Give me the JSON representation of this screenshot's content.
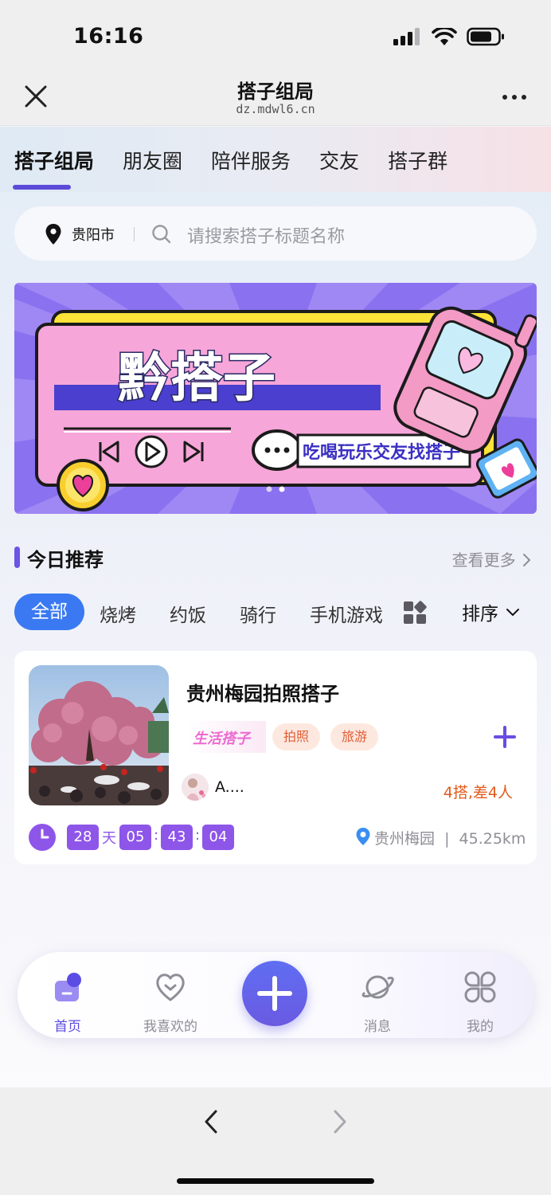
{
  "status": {
    "time": "16:16"
  },
  "nav": {
    "title": "搭子组局",
    "url": "dz.mdwl6.cn"
  },
  "tabs": [
    {
      "label": "搭子组局",
      "active": true
    },
    {
      "label": "朋友圈"
    },
    {
      "label": "陪伴服务"
    },
    {
      "label": "交友"
    },
    {
      "label": "搭子群"
    }
  ],
  "search": {
    "city": "贵阳市",
    "placeholder": "请搜索搭子标题名称"
  },
  "banner": {
    "title": "黔搭子",
    "subtitle": "吃喝玩乐交友找搭子",
    "page_count": 2,
    "active_page": 2
  },
  "section": {
    "title": "今日推荐",
    "more": "查看更多"
  },
  "categories": [
    {
      "label": "全部",
      "active": true
    },
    {
      "label": "烧烤"
    },
    {
      "label": "约饭"
    },
    {
      "label": "骑行"
    },
    {
      "label": "手机游戏"
    }
  ],
  "sort_label": "排序",
  "card": {
    "title": "贵州梅园拍照搭子",
    "type_tag": "生活搭子",
    "tags": [
      "拍照",
      "旅游"
    ],
    "author": "A....",
    "need": "4搭,差4人",
    "countdown": {
      "days": "28",
      "day_unit": "天",
      "hours": "05",
      "minutes": "43",
      "seconds": "04"
    },
    "location": "贵州梅园",
    "distance": "45.25km"
  },
  "bottom_nav": [
    {
      "label": "首页",
      "icon": "home-icon",
      "active": true
    },
    {
      "label": "我喜欢的",
      "icon": "heart-icon"
    },
    {
      "label": "消息",
      "icon": "planet-icon"
    },
    {
      "label": "我的",
      "icon": "grid-icon"
    }
  ],
  "colors": {
    "accent": "#5b4bd8",
    "blue": "#3a79f2",
    "countdown": "#8e55e9",
    "warning": "#e25a1c"
  }
}
